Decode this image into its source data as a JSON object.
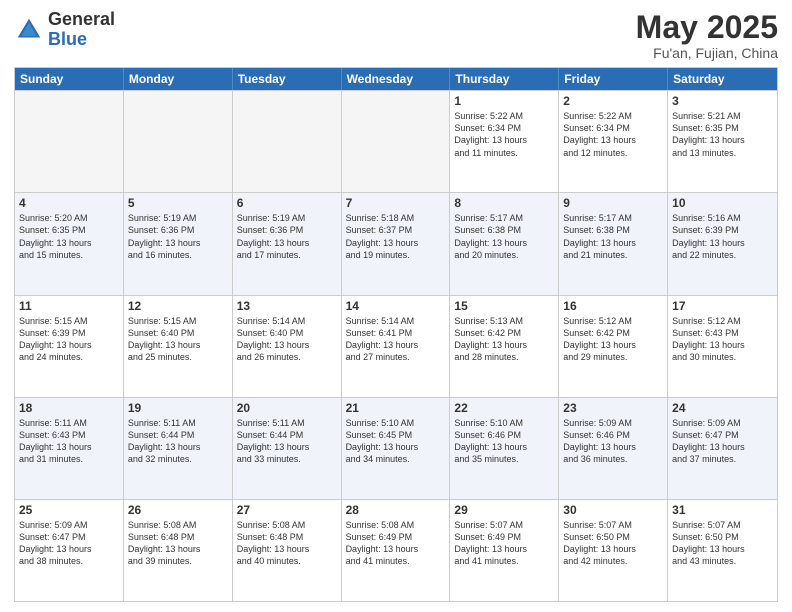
{
  "header": {
    "logo_general": "General",
    "logo_blue": "Blue",
    "month_title": "May 2025",
    "location": "Fu'an, Fujian, China"
  },
  "weekdays": [
    "Sunday",
    "Monday",
    "Tuesday",
    "Wednesday",
    "Thursday",
    "Friday",
    "Saturday"
  ],
  "rows": [
    {
      "alt": false,
      "cells": [
        {
          "empty": true,
          "day": "",
          "lines": []
        },
        {
          "empty": true,
          "day": "",
          "lines": []
        },
        {
          "empty": true,
          "day": "",
          "lines": []
        },
        {
          "empty": true,
          "day": "",
          "lines": []
        },
        {
          "empty": false,
          "day": "1",
          "lines": [
            "Sunrise: 5:22 AM",
            "Sunset: 6:34 PM",
            "Daylight: 13 hours",
            "and 11 minutes."
          ]
        },
        {
          "empty": false,
          "day": "2",
          "lines": [
            "Sunrise: 5:22 AM",
            "Sunset: 6:34 PM",
            "Daylight: 13 hours",
            "and 12 minutes."
          ]
        },
        {
          "empty": false,
          "day": "3",
          "lines": [
            "Sunrise: 5:21 AM",
            "Sunset: 6:35 PM",
            "Daylight: 13 hours",
            "and 13 minutes."
          ]
        }
      ]
    },
    {
      "alt": true,
      "cells": [
        {
          "empty": false,
          "day": "4",
          "lines": [
            "Sunrise: 5:20 AM",
            "Sunset: 6:35 PM",
            "Daylight: 13 hours",
            "and 15 minutes."
          ]
        },
        {
          "empty": false,
          "day": "5",
          "lines": [
            "Sunrise: 5:19 AM",
            "Sunset: 6:36 PM",
            "Daylight: 13 hours",
            "and 16 minutes."
          ]
        },
        {
          "empty": false,
          "day": "6",
          "lines": [
            "Sunrise: 5:19 AM",
            "Sunset: 6:36 PM",
            "Daylight: 13 hours",
            "and 17 minutes."
          ]
        },
        {
          "empty": false,
          "day": "7",
          "lines": [
            "Sunrise: 5:18 AM",
            "Sunset: 6:37 PM",
            "Daylight: 13 hours",
            "and 19 minutes."
          ]
        },
        {
          "empty": false,
          "day": "8",
          "lines": [
            "Sunrise: 5:17 AM",
            "Sunset: 6:38 PM",
            "Daylight: 13 hours",
            "and 20 minutes."
          ]
        },
        {
          "empty": false,
          "day": "9",
          "lines": [
            "Sunrise: 5:17 AM",
            "Sunset: 6:38 PM",
            "Daylight: 13 hours",
            "and 21 minutes."
          ]
        },
        {
          "empty": false,
          "day": "10",
          "lines": [
            "Sunrise: 5:16 AM",
            "Sunset: 6:39 PM",
            "Daylight: 13 hours",
            "and 22 minutes."
          ]
        }
      ]
    },
    {
      "alt": false,
      "cells": [
        {
          "empty": false,
          "day": "11",
          "lines": [
            "Sunrise: 5:15 AM",
            "Sunset: 6:39 PM",
            "Daylight: 13 hours",
            "and 24 minutes."
          ]
        },
        {
          "empty": false,
          "day": "12",
          "lines": [
            "Sunrise: 5:15 AM",
            "Sunset: 6:40 PM",
            "Daylight: 13 hours",
            "and 25 minutes."
          ]
        },
        {
          "empty": false,
          "day": "13",
          "lines": [
            "Sunrise: 5:14 AM",
            "Sunset: 6:40 PM",
            "Daylight: 13 hours",
            "and 26 minutes."
          ]
        },
        {
          "empty": false,
          "day": "14",
          "lines": [
            "Sunrise: 5:14 AM",
            "Sunset: 6:41 PM",
            "Daylight: 13 hours",
            "and 27 minutes."
          ]
        },
        {
          "empty": false,
          "day": "15",
          "lines": [
            "Sunrise: 5:13 AM",
            "Sunset: 6:42 PM",
            "Daylight: 13 hours",
            "and 28 minutes."
          ]
        },
        {
          "empty": false,
          "day": "16",
          "lines": [
            "Sunrise: 5:12 AM",
            "Sunset: 6:42 PM",
            "Daylight: 13 hours",
            "and 29 minutes."
          ]
        },
        {
          "empty": false,
          "day": "17",
          "lines": [
            "Sunrise: 5:12 AM",
            "Sunset: 6:43 PM",
            "Daylight: 13 hours",
            "and 30 minutes."
          ]
        }
      ]
    },
    {
      "alt": true,
      "cells": [
        {
          "empty": false,
          "day": "18",
          "lines": [
            "Sunrise: 5:11 AM",
            "Sunset: 6:43 PM",
            "Daylight: 13 hours",
            "and 31 minutes."
          ]
        },
        {
          "empty": false,
          "day": "19",
          "lines": [
            "Sunrise: 5:11 AM",
            "Sunset: 6:44 PM",
            "Daylight: 13 hours",
            "and 32 minutes."
          ]
        },
        {
          "empty": false,
          "day": "20",
          "lines": [
            "Sunrise: 5:11 AM",
            "Sunset: 6:44 PM",
            "Daylight: 13 hours",
            "and 33 minutes."
          ]
        },
        {
          "empty": false,
          "day": "21",
          "lines": [
            "Sunrise: 5:10 AM",
            "Sunset: 6:45 PM",
            "Daylight: 13 hours",
            "and 34 minutes."
          ]
        },
        {
          "empty": false,
          "day": "22",
          "lines": [
            "Sunrise: 5:10 AM",
            "Sunset: 6:46 PM",
            "Daylight: 13 hours",
            "and 35 minutes."
          ]
        },
        {
          "empty": false,
          "day": "23",
          "lines": [
            "Sunrise: 5:09 AM",
            "Sunset: 6:46 PM",
            "Daylight: 13 hours",
            "and 36 minutes."
          ]
        },
        {
          "empty": false,
          "day": "24",
          "lines": [
            "Sunrise: 5:09 AM",
            "Sunset: 6:47 PM",
            "Daylight: 13 hours",
            "and 37 minutes."
          ]
        }
      ]
    },
    {
      "alt": false,
      "cells": [
        {
          "empty": false,
          "day": "25",
          "lines": [
            "Sunrise: 5:09 AM",
            "Sunset: 6:47 PM",
            "Daylight: 13 hours",
            "and 38 minutes."
          ]
        },
        {
          "empty": false,
          "day": "26",
          "lines": [
            "Sunrise: 5:08 AM",
            "Sunset: 6:48 PM",
            "Daylight: 13 hours",
            "and 39 minutes."
          ]
        },
        {
          "empty": false,
          "day": "27",
          "lines": [
            "Sunrise: 5:08 AM",
            "Sunset: 6:48 PM",
            "Daylight: 13 hours",
            "and 40 minutes."
          ]
        },
        {
          "empty": false,
          "day": "28",
          "lines": [
            "Sunrise: 5:08 AM",
            "Sunset: 6:49 PM",
            "Daylight: 13 hours",
            "and 41 minutes."
          ]
        },
        {
          "empty": false,
          "day": "29",
          "lines": [
            "Sunrise: 5:07 AM",
            "Sunset: 6:49 PM",
            "Daylight: 13 hours",
            "and 41 minutes."
          ]
        },
        {
          "empty": false,
          "day": "30",
          "lines": [
            "Sunrise: 5:07 AM",
            "Sunset: 6:50 PM",
            "Daylight: 13 hours",
            "and 42 minutes."
          ]
        },
        {
          "empty": false,
          "day": "31",
          "lines": [
            "Sunrise: 5:07 AM",
            "Sunset: 6:50 PM",
            "Daylight: 13 hours",
            "and 43 minutes."
          ]
        }
      ]
    }
  ]
}
